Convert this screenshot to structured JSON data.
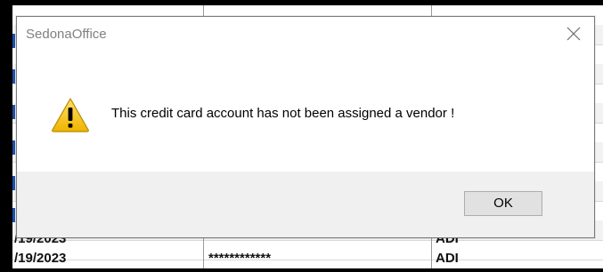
{
  "dialog": {
    "title": "SedonaOffice",
    "message": "This credit card account has not been assigned a vendor !",
    "ok_label": "OK",
    "icon": "warning-icon",
    "close_icon": "close-icon"
  },
  "background_grid": {
    "visible_fragments": [
      {
        "text": "/19/2023"
      },
      {
        "text": "ADI"
      },
      {
        "text": "/19/2023"
      },
      {
        "text": "************"
      },
      {
        "text": "ADI"
      }
    ]
  },
  "colors": {
    "accent_blue": "#1c4fa8",
    "footer_gray": "#f0f0f0",
    "button_gray": "#e1e1e1",
    "warning_yellow": "#f5c400"
  }
}
